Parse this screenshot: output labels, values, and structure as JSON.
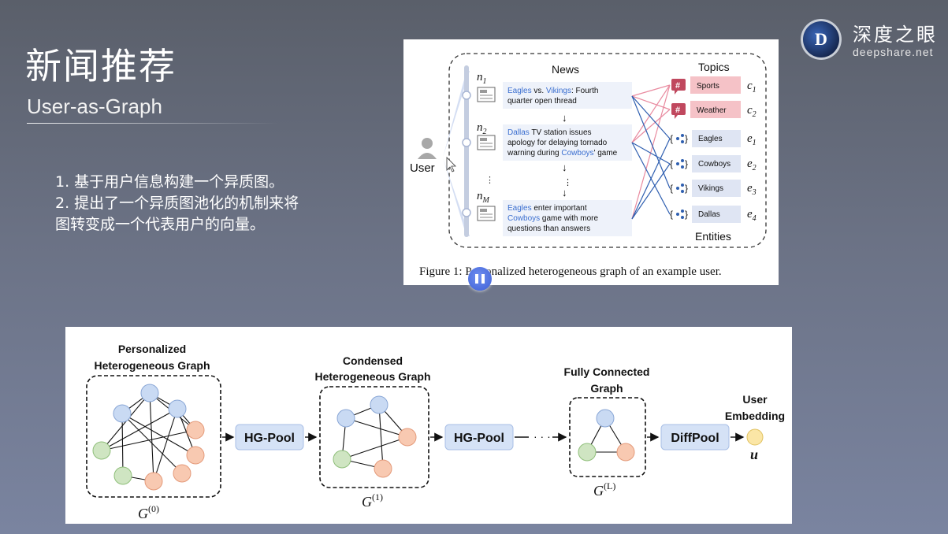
{
  "slide": {
    "title": "新闻推荐",
    "subtitle": "User-as-Graph",
    "points": [
      "1.  基于用户信息构建一个异质图。",
      "2.  提出了一个异质图池化的机制来将",
      "图转变成一个代表用户的向量。"
    ]
  },
  "logo": {
    "mark": "D",
    "cn": "深度之眼",
    "en": "deepshare.net"
  },
  "figure1": {
    "caption": "Figure 1: Personalized heterogeneous graph of an example user.",
    "user_label": "User",
    "news_header": "News",
    "topics_header": "Topics",
    "entities_header": "Entities",
    "news_ids": [
      "n",
      "n",
      "n"
    ],
    "news_subs": [
      "1",
      "2",
      "M"
    ],
    "news_items": [
      {
        "segments": [
          "Eagles",
          " vs. ",
          "Vikings",
          ": Fourth"
        ],
        "line2": "quarter open thread"
      },
      {
        "segments": [
          "Dallas",
          " TV station issues"
        ],
        "line2": "apology for delaying tornado",
        "line3_parts": [
          "warning during ",
          "Cowboys",
          "' game"
        ]
      },
      {
        "segments": [
          "Eagles",
          " enter important"
        ],
        "line2_parts": [
          "Cowboys",
          " game with more"
        ],
        "line3": "questions than answers"
      }
    ],
    "topics": [
      {
        "label": "Sports",
        "sym": "c",
        "sub": "1"
      },
      {
        "label": "Weather",
        "sym": "c",
        "sub": "2"
      }
    ],
    "entities": [
      {
        "label": "Eagles",
        "sym": "e",
        "sub": "1"
      },
      {
        "label": "Cowboys",
        "sym": "e",
        "sub": "2"
      },
      {
        "label": "Vikings",
        "sym": "e",
        "sub": "3"
      },
      {
        "label": "Dallas",
        "sym": "e",
        "sub": "4"
      }
    ],
    "arrows": [
      "↓",
      "↓",
      "↓"
    ],
    "ellipsis": "⋮",
    "colors": {
      "entity_blue": "#3b6fd0",
      "topic_pink": "#f5c2c7",
      "entity_box": "#dfe5f3",
      "news_box": "#eef2fa",
      "red_link": "#e98ba0",
      "blue_link": "#2f5fb0"
    }
  },
  "figure2": {
    "stages": [
      {
        "title_l1": "Personalized",
        "title_l2": "Heterogeneous Graph",
        "graph_sym": "G",
        "graph_sup": "(0)"
      },
      {
        "title_l1": "Condensed",
        "title_l2": "Heterogeneous Graph",
        "graph_sym": "G",
        "graph_sup": "(1)"
      },
      {
        "title_l1": "Fully Connected",
        "title_l2": "Graph",
        "graph_sym": "G",
        "graph_sup": "(L)"
      }
    ],
    "ops": [
      "HG-Pool",
      "HG-Pool",
      "DiffPool"
    ],
    "dots": "· · ·",
    "output_l1": "User",
    "output_l2": "Embedding",
    "output_sym": "u",
    "colors": {
      "node_blue": "#c9daf3",
      "node_orange": "#f8c9b1",
      "node_green": "#cfe5c2",
      "node_yellow": "#fbe6a6",
      "op_box": "#d5e2f6"
    }
  }
}
